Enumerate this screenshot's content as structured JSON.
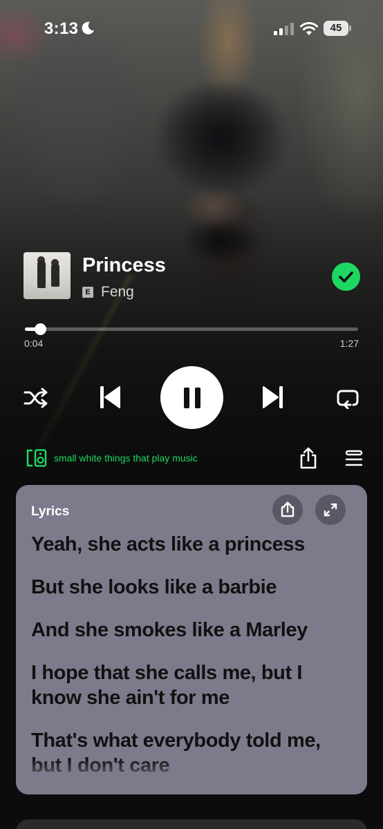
{
  "status_bar": {
    "time": "3:13",
    "battery": "45"
  },
  "track": {
    "title": "Princess",
    "explicit": "E",
    "artist": "Feng",
    "liked": true
  },
  "progress": {
    "elapsed": "0:04",
    "total": "1:27",
    "fraction": 0.046
  },
  "controls": {
    "shuffle_icon": "shuffle-icon",
    "previous_icon": "skip-previous-icon",
    "play_state_icon": "pause-icon",
    "next_icon": "skip-next-icon",
    "repeat_icon": "repeat-icon"
  },
  "device": {
    "icon": "speaker-icon",
    "name": "small white things that play music"
  },
  "lyrics": {
    "header": "Lyrics",
    "lines": [
      "Yeah, she acts like a princess",
      "But she looks like a barbie",
      "And she smokes like a Marley",
      "I hope that she calls me, but I know she ain't for me",
      "That's what everybody told me, but I don't care"
    ]
  },
  "colors": {
    "accent": "#1ed760",
    "lyrics_card": "#7c7b8c"
  }
}
